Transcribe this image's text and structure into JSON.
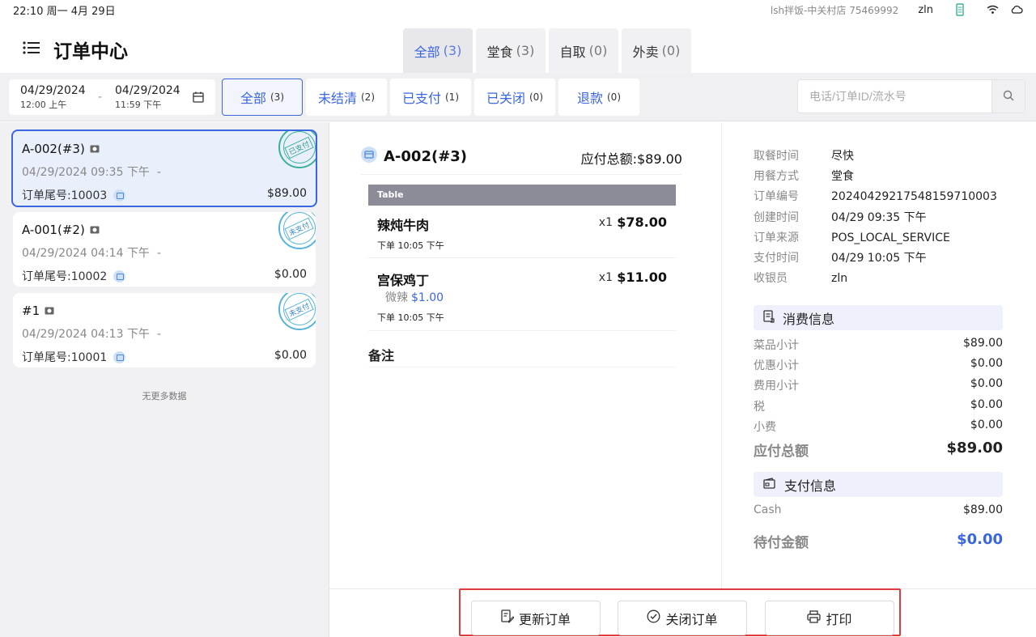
{
  "status_bar": {
    "time": "22:10 周一 4月 29日",
    "store": "lsh拌饭-中关村店 75469992",
    "user": "zln"
  },
  "header": {
    "title": "订单中心"
  },
  "type_tabs": [
    {
      "label": "全部",
      "count": "(3)",
      "active": true
    },
    {
      "label": "堂食",
      "count": "(3)",
      "active": false
    },
    {
      "label": "自取",
      "count": "(0)",
      "active": false
    },
    {
      "label": "外卖",
      "count": "(0)",
      "active": false
    }
  ],
  "date_range": {
    "start_date": "04/29/2024",
    "start_time": "12:00 上午",
    "separator": "-",
    "end_date": "04/29/2024",
    "end_time": "11:59 下午"
  },
  "status_tabs": [
    {
      "label": "全部",
      "count": "(3)",
      "active": true
    },
    {
      "label": "未结清",
      "count": "(2)",
      "active": false
    },
    {
      "label": "已支付",
      "count": "(1)",
      "active": false
    },
    {
      "label": "已关闭",
      "count": "(0)",
      "active": false
    },
    {
      "label": "退款",
      "count": "(0)",
      "active": false
    }
  ],
  "search": {
    "placeholder": "电话/订单ID/流水号",
    "value": ""
  },
  "orders": [
    {
      "title": "A-002(#3)",
      "time": "04/29/2024 09:35 下午",
      "dash": "-",
      "tail": "订单尾号:10003",
      "amount": "$89.00",
      "stamp": "已支付",
      "selected": true
    },
    {
      "title": "A-001(#2)",
      "time": "04/29/2024 04:14 下午",
      "dash": "-",
      "tail": "订单尾号:10002",
      "amount": "$0.00",
      "stamp": "未支付",
      "selected": false
    },
    {
      "title": "#1",
      "time": "04/29/2024 04:13 下午",
      "dash": "-",
      "tail": "订单尾号:10001",
      "amount": "$0.00",
      "stamp": "未支付",
      "selected": false
    }
  ],
  "no_more": "无更多数据",
  "detail": {
    "title": "A-002(#3)",
    "total_label": "应付总额:$89.00",
    "table_label": "Table",
    "items": [
      {
        "name": "辣炖牛肉",
        "qty": "x1",
        "price": "$78.00",
        "time": "下单 10:05 下午",
        "modifier": "",
        "modifier_price": ""
      },
      {
        "name": "宫保鸡丁",
        "qty": "x1",
        "price": "$11.00",
        "time": "下单 10:05 下午",
        "modifier": "微辣",
        "modifier_price": "$1.00"
      }
    ],
    "remark_label": "备注"
  },
  "info": [
    {
      "label": "取餐时间",
      "value": "尽快"
    },
    {
      "label": "用餐方式",
      "value": "堂食"
    },
    {
      "label": "订单编号",
      "value": "20240429217548159710003"
    },
    {
      "label": "创建时间",
      "value": "04/29 09:35 下午"
    },
    {
      "label": "订单来源",
      "value": "POS_LOCAL_SERVICE"
    },
    {
      "label": "支付时间",
      "value": "04/29 10:05 下午"
    },
    {
      "label": "收银员",
      "value": "zln"
    }
  ],
  "consumption": {
    "title": "消费信息",
    "rows": [
      {
        "label": "菜品小计",
        "value": "$89.00"
      },
      {
        "label": "优惠小计",
        "value": "$0.00"
      },
      {
        "label": "费用小计",
        "value": "$0.00"
      },
      {
        "label": "税",
        "value": "$0.00"
      },
      {
        "label": "小费",
        "value": "$0.00"
      }
    ],
    "total_label": "应付总额",
    "total_value": "$89.00"
  },
  "payment": {
    "title": "支付信息",
    "rows": [
      {
        "label": "Cash",
        "value": "$89.00"
      }
    ],
    "due_label": "待付金额",
    "due_value": "$0.00"
  },
  "actions": {
    "update": "更新订单",
    "close": "关闭订单",
    "print": "打印"
  },
  "colors": {
    "accent": "#3a66e0",
    "highlight": "#e23b3b"
  }
}
